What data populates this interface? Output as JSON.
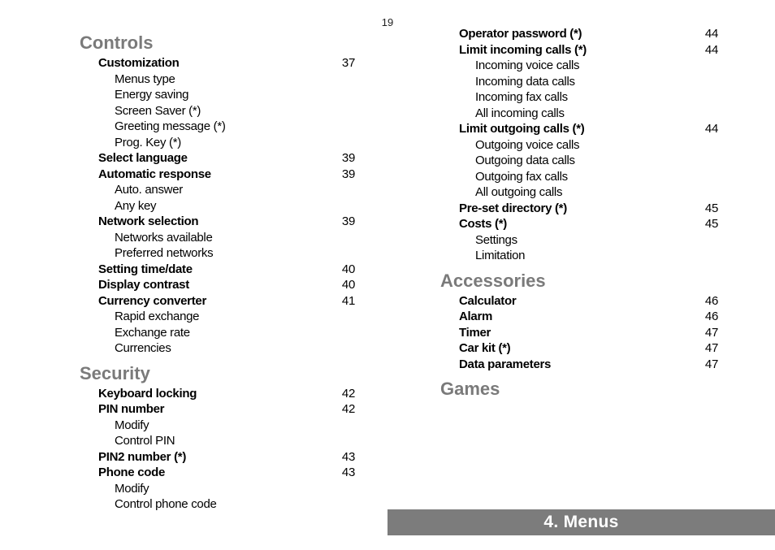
{
  "page_number": "19",
  "chapter_bar": "4. Menus",
  "left_column": [
    {
      "type": "heading",
      "text": "Controls"
    },
    {
      "type": "entry",
      "text": "Customization",
      "page": "37"
    },
    {
      "type": "sub",
      "text": "Menus type"
    },
    {
      "type": "sub",
      "text": "Energy saving"
    },
    {
      "type": "sub",
      "text": "Screen Saver (*)"
    },
    {
      "type": "sub",
      "text": "Greeting message (*)"
    },
    {
      "type": "sub",
      "text": "Prog. Key (*)"
    },
    {
      "type": "entry",
      "text": "Select language",
      "page": "39"
    },
    {
      "type": "entry",
      "text": "Automatic response",
      "page": "39"
    },
    {
      "type": "sub",
      "text": "Auto. answer"
    },
    {
      "type": "sub",
      "text": "Any key"
    },
    {
      "type": "entry",
      "text": "Network selection",
      "page": "39"
    },
    {
      "type": "sub",
      "text": "Networks available"
    },
    {
      "type": "sub",
      "text": "Preferred networks"
    },
    {
      "type": "entry",
      "text": "Setting time/date",
      "page": "40"
    },
    {
      "type": "entry",
      "text": "Display contrast",
      "page": "40"
    },
    {
      "type": "entry",
      "text": "Currency converter",
      "page": "41"
    },
    {
      "type": "sub",
      "text": "Rapid exchange"
    },
    {
      "type": "sub",
      "text": "Exchange rate"
    },
    {
      "type": "sub",
      "text": "Currencies"
    },
    {
      "type": "heading",
      "text": "Security"
    },
    {
      "type": "entry",
      "text": "Keyboard locking",
      "page": "42"
    },
    {
      "type": "entry",
      "text": "PIN number",
      "page": "42"
    },
    {
      "type": "sub",
      "text": "Modify"
    },
    {
      "type": "sub",
      "text": "Control PIN"
    },
    {
      "type": "entry",
      "text": "PIN2 number (*)",
      "page": "43"
    },
    {
      "type": "entry",
      "text": "Phone code",
      "page": "43"
    },
    {
      "type": "sub",
      "text": "Modify"
    },
    {
      "type": "sub",
      "text": "Control phone code"
    }
  ],
  "right_column": [
    {
      "type": "entry",
      "text": "Operator password (*)",
      "page": "44"
    },
    {
      "type": "entry",
      "text": "Limit incoming calls (*)",
      "page": "44"
    },
    {
      "type": "sub",
      "text": "Incoming voice calls"
    },
    {
      "type": "sub",
      "text": "Incoming data calls"
    },
    {
      "type": "sub",
      "text": "Incoming fax calls"
    },
    {
      "type": "sub",
      "text": "All incoming calls"
    },
    {
      "type": "entry",
      "text": "Limit outgoing calls (*)",
      "page": "44"
    },
    {
      "type": "sub",
      "text": "Outgoing voice calls"
    },
    {
      "type": "sub",
      "text": "Outgoing data calls"
    },
    {
      "type": "sub",
      "text": "Outgoing fax calls"
    },
    {
      "type": "sub",
      "text": "All outgoing calls"
    },
    {
      "type": "entry",
      "text": "Pre-set directory (*)",
      "page": "45"
    },
    {
      "type": "entry",
      "text": "Costs (*)",
      "page": "45"
    },
    {
      "type": "sub",
      "text": "Settings"
    },
    {
      "type": "sub",
      "text": "Limitation"
    },
    {
      "type": "heading",
      "text": "Accessories"
    },
    {
      "type": "entry",
      "text": "Calculator",
      "page": "46"
    },
    {
      "type": "entry",
      "text": "Alarm",
      "page": "46"
    },
    {
      "type": "entry",
      "text": "Timer",
      "page": "47"
    },
    {
      "type": "entry",
      "text": "Car kit (*)",
      "page": "47"
    },
    {
      "type": "entry",
      "text": "Data parameters",
      "page": "47"
    },
    {
      "type": "heading",
      "text": "Games"
    }
  ]
}
